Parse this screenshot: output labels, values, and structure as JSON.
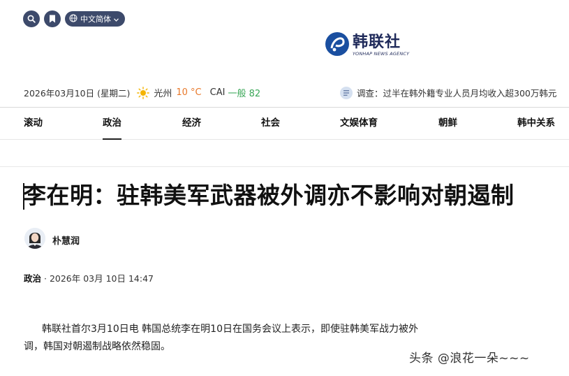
{
  "header": {
    "language_label": "中文简体",
    "logo": {
      "name_cn": "韩联社",
      "name_en": "YONHAP NEWS AGENCY"
    }
  },
  "infobar": {
    "date": "2026年03月10日 (星期二)",
    "city": "光州",
    "temperature": "10 °C",
    "cai_label": "CAI",
    "cai_value": "一般 82",
    "survey_text": "调查：过半在韩外籍专业人员月均收入超300万韩元"
  },
  "nav": {
    "items": [
      {
        "label": "滚动"
      },
      {
        "label": "政治",
        "active": true
      },
      {
        "label": "经济"
      },
      {
        "label": "社会"
      },
      {
        "label": "文娱体育"
      },
      {
        "label": "朝鲜"
      },
      {
        "label": "韩中关系"
      }
    ]
  },
  "article": {
    "headline": "李在明：驻韩美军武器被外调亦不影响对朝遏制",
    "author": "朴慧润",
    "category": "政治",
    "meta_sep": " · ",
    "datetime": "2026年 03月 10日 14:47",
    "body_line1": "韩联社首尔3月10日电 韩国总统李在明10日在国务会议上表示，即使驻韩美军战力被外",
    "body_line2": "调，韩国对朝遏制战略依然稳固。"
  },
  "watermark": "头条 @浪花一朵~~~",
  "colors": {
    "nav_dark": "#3d4a6b",
    "logo_blue": "#1a4fa0",
    "temperature": "#e8782a",
    "cai_good": "#3aa757"
  }
}
